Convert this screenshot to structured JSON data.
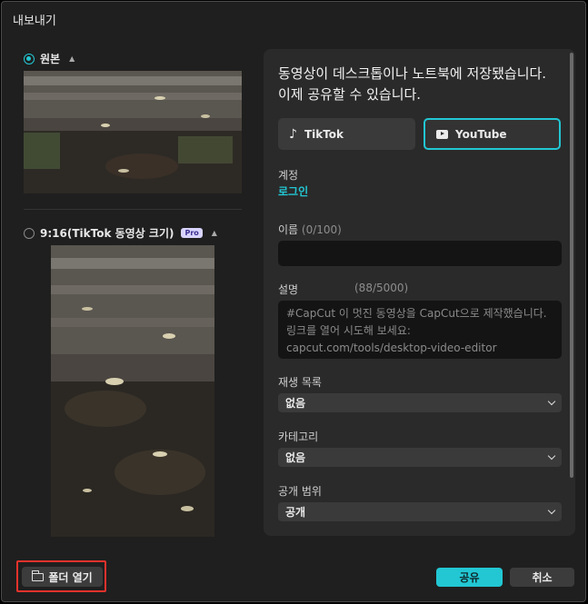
{
  "window": {
    "title": "내보내기"
  },
  "formats": [
    {
      "label": "원본",
      "selected": true
    },
    {
      "label": "9:16(TikTok 동영상 크기)",
      "badge": "Pro",
      "selected": false
    }
  ],
  "share": {
    "headline": "동영상이 데스크톱이나 노트북에 저장됐습니다. 이제 공유할 수 있습니다.",
    "platforms": [
      {
        "label": "TikTok",
        "icon": "tiktok-icon",
        "selected": false
      },
      {
        "label": "YouTube",
        "icon": "youtube-icon",
        "selected": true
      }
    ],
    "account_label": "계정",
    "login_link": "로그인",
    "name_label": "이름",
    "name_count": "(0/100)",
    "name_value": "",
    "desc_label": "설명",
    "desc_count": "(88/5000)",
    "desc_value": "#CapCut 이 멋진 동영상을 CapCut으로 제작했습니다. 링크를 열어 시도해 보세요: capcut.com/tools/desktop-video-editor",
    "playlist_label": "재생 목록",
    "playlist_value": "없음",
    "category_label": "카테고리",
    "category_value": "없음",
    "visibility_label": "공개 범위",
    "visibility_value": "공개"
  },
  "footer": {
    "open_folder": "폴더 열기",
    "share": "공유",
    "cancel": "취소"
  },
  "colors": {
    "accent": "#22c7d3",
    "highlight": "#e8322c",
    "background": "#1f1f1f"
  }
}
